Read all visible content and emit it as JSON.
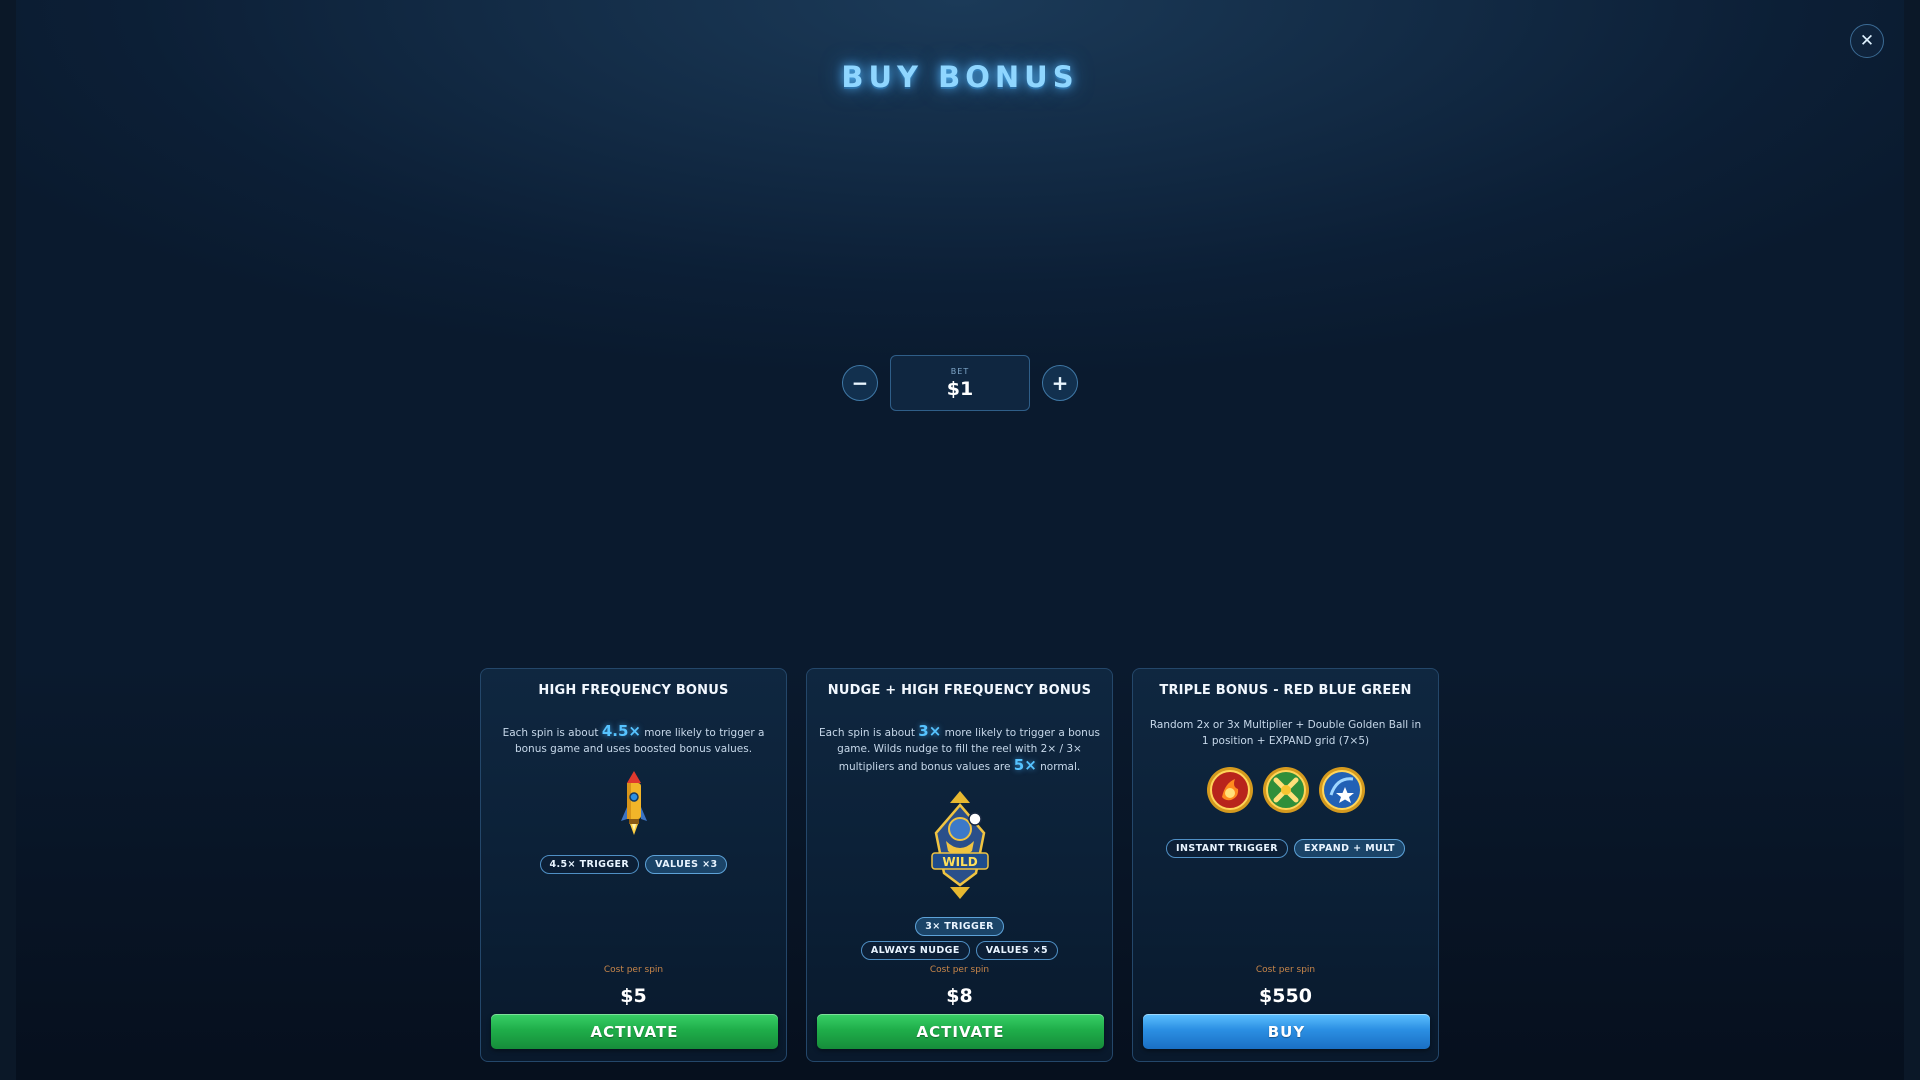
{
  "title": "BUY BONUS",
  "close_icon": "close-icon",
  "bet": {
    "label": "BET",
    "value": "$1",
    "decrease_label": "−",
    "increase_label": "+"
  },
  "cards": [
    {
      "title": "HIGH FREQUENCY BONUS",
      "desc_pre": "Each spin is about ",
      "desc_hl1": "4.5×",
      "desc_mid": " more likely to trigger a bonus game and uses boosted bonus values.",
      "icon": "rocket-icon",
      "tags": [
        "4.5× TRIGGER",
        "VALUES ×3"
      ],
      "cost_label": "Cost per spin",
      "cost": "$5",
      "button": "ACTIVATE"
    },
    {
      "title": "NUDGE + HIGH FREQUENCY BONUS",
      "desc_pre": "Each spin is about ",
      "desc_hl1": "3×",
      "desc_mid": " more likely to trigger a bonus game. Wilds nudge to fill the reel with 2× / 3× multipliers and bonus values are ",
      "desc_hl2": "5×",
      "desc_post": " normal.",
      "icon": "wild-symbol-icon",
      "icon_text": "WILD",
      "tags": [
        "3× TRIGGER",
        "ALWAYS NUDGE",
        "VALUES ×5"
      ],
      "cost_label": "Cost per spin",
      "cost": "$8",
      "button": "ACTIVATE"
    },
    {
      "title": "TRIPLE BONUS - RED BLUE GREEN",
      "desc": "Random 2x or 3x Multiplier + Double Golden Ball in 1 position + EXPAND grid (7×5)",
      "icons": [
        "red-fireball-coin-icon",
        "green-cross-coin-icon",
        "blue-star-coin-icon"
      ],
      "tags": [
        "INSTANT TRIGGER",
        "EXPAND + MULT"
      ],
      "cost_label": "Cost per spin",
      "cost": "$550",
      "button": "BUY"
    }
  ],
  "colors": {
    "accent": "#56c3ff",
    "activate_button": "#1fae4a",
    "buy_button": "#2b8fe3",
    "cost_label": "#c8864a"
  }
}
